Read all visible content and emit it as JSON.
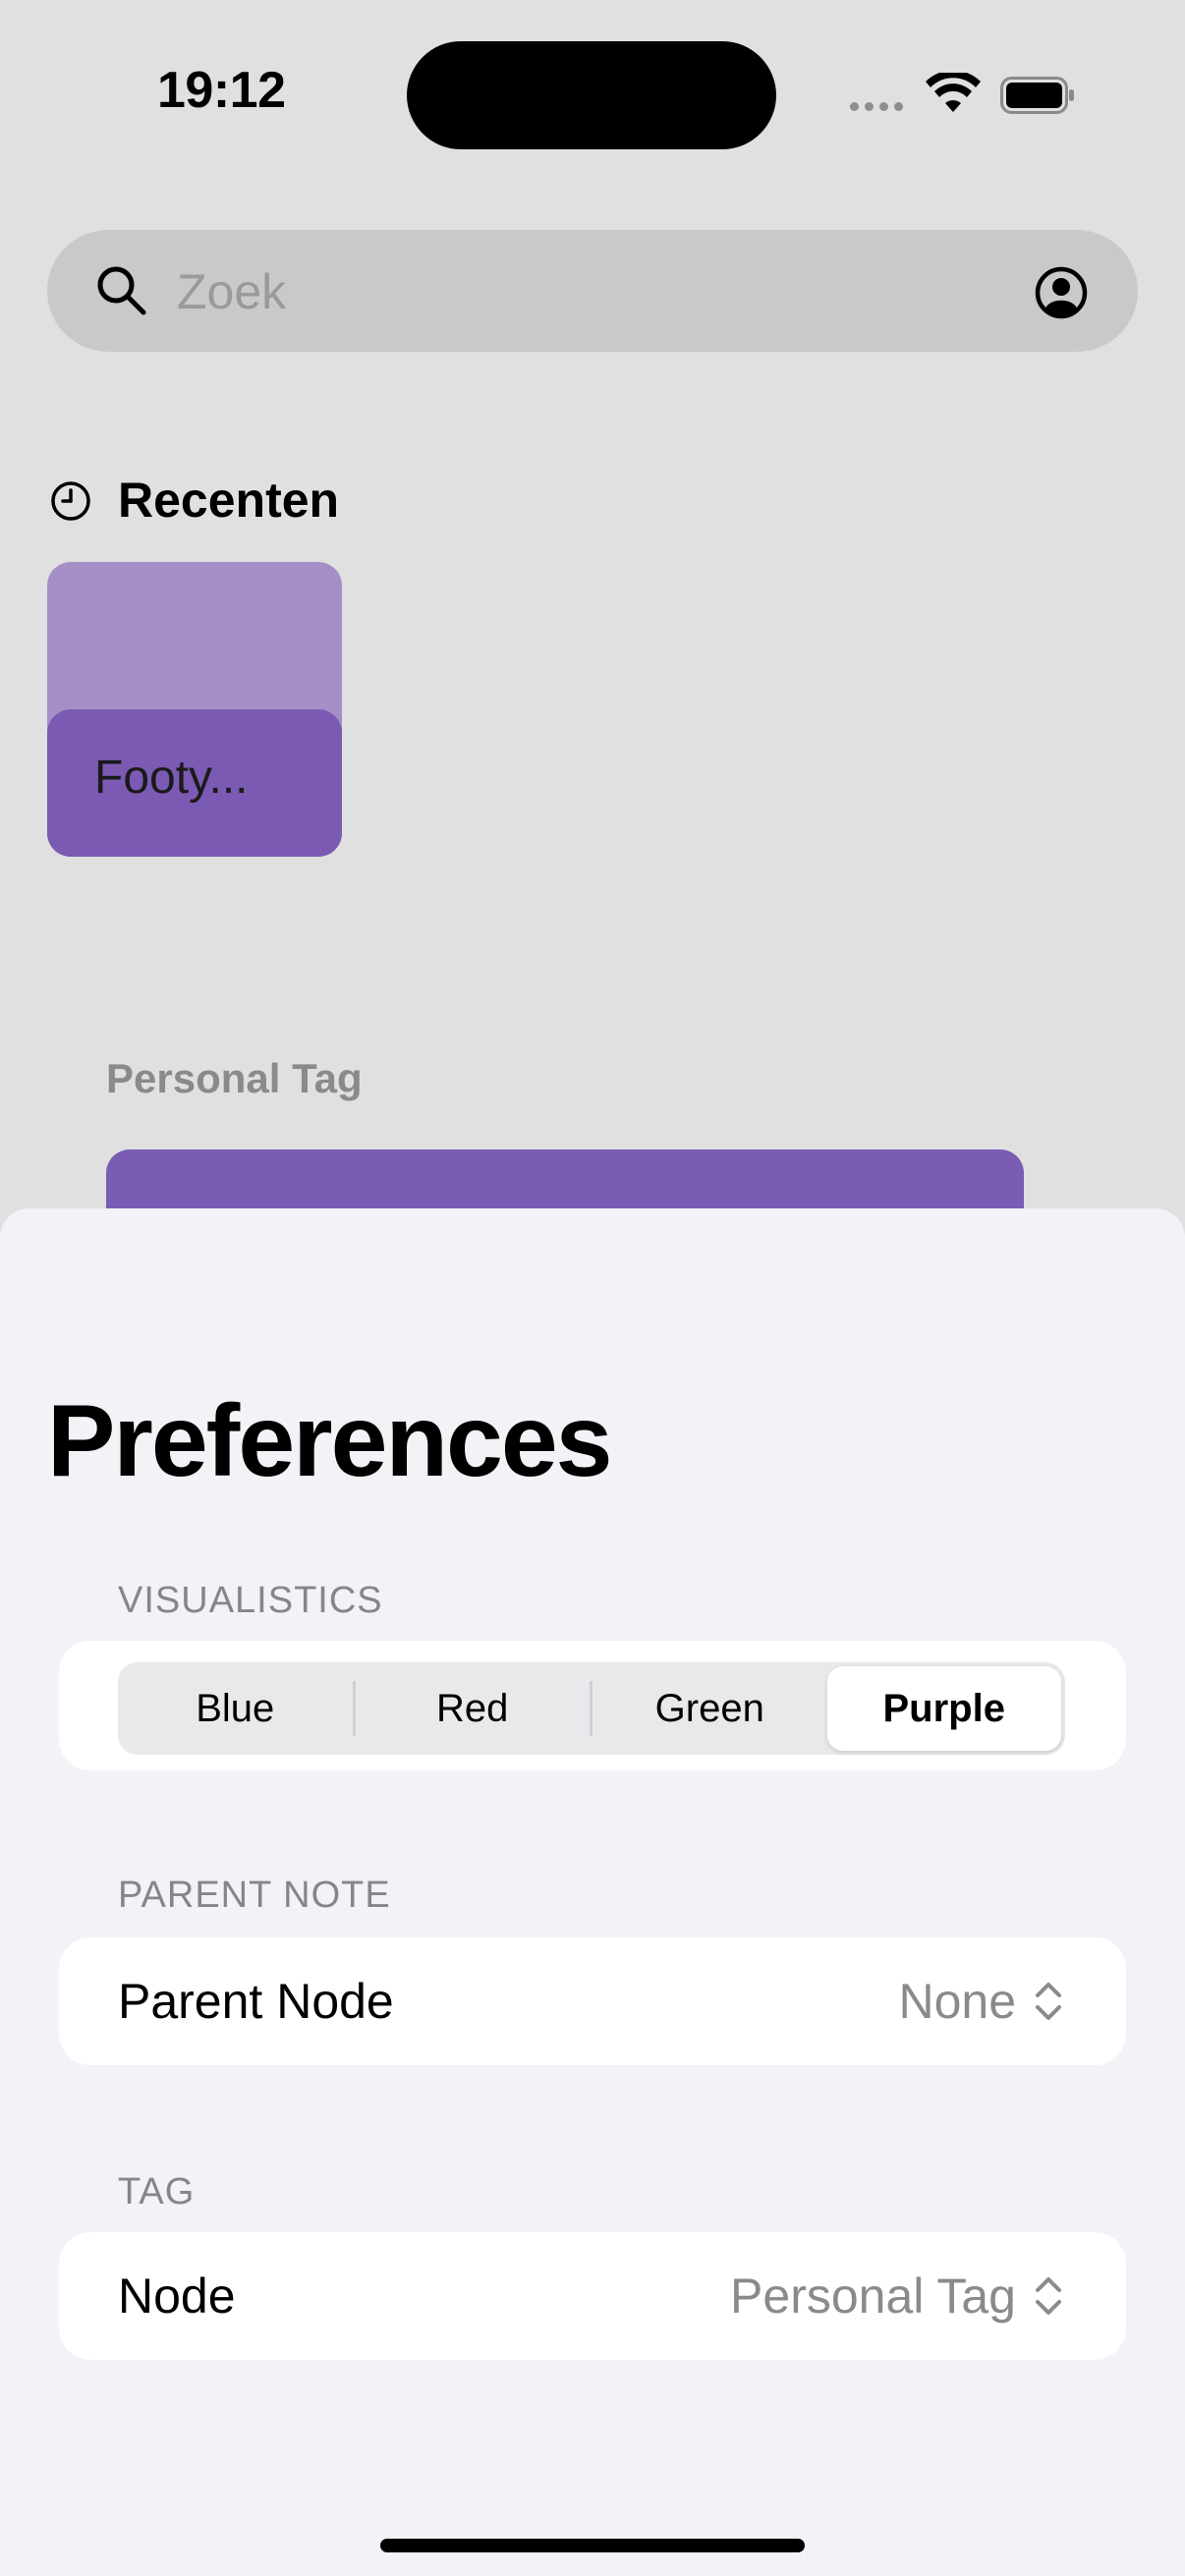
{
  "status_bar": {
    "time": "19:12"
  },
  "search": {
    "placeholder": "Zoek"
  },
  "recents": {
    "title": "Recenten",
    "items": [
      {
        "label": "Footy..."
      }
    ]
  },
  "background_list": {
    "section_heading": "Personal Tag"
  },
  "sheet": {
    "title": "Preferences",
    "visualistics": {
      "label": "VISUALISTICS",
      "options": [
        "Blue",
        "Red",
        "Green",
        "Purple"
      ],
      "selected": "Purple"
    },
    "parent_note": {
      "label": "PARENT NOTE",
      "row_label": "Parent Node",
      "row_value": "None"
    },
    "tag": {
      "label": "TAG",
      "row_label": "Node",
      "row_value": "Personal Tag"
    }
  },
  "colors": {
    "accent_purple": "#7b5ab4",
    "card_top_purple": "#a68fc7",
    "sheet_background": "#f2f2f7"
  }
}
